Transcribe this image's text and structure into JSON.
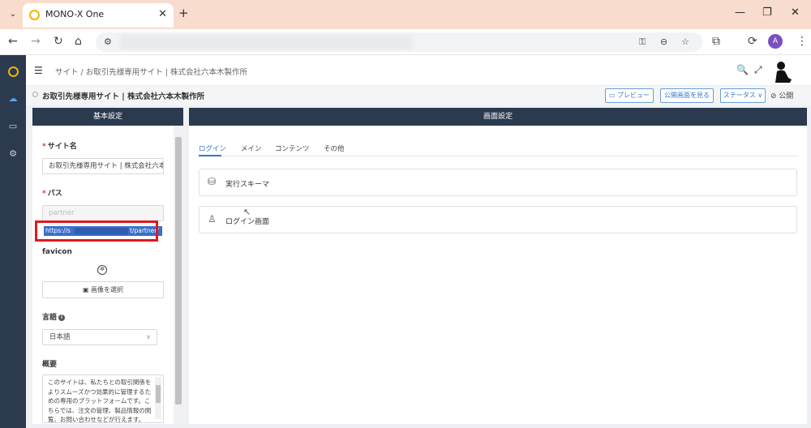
{
  "browser": {
    "tab_title": "MONO-X One",
    "tab_close": "✕",
    "new_tab": "+",
    "menu": "⌄",
    "window_minimize": "—",
    "window_restore": "❐",
    "window_close": "✕"
  },
  "toolbar": {
    "back": "←",
    "forward": "→",
    "reload": "↻",
    "home": "⌂",
    "site_info": "⚙",
    "key": "⚿",
    "zoom": "⊖",
    "bookmark": "☆",
    "extensions": "⧉",
    "sync": "⟳",
    "profile_initial": "A",
    "more": "⋮"
  },
  "header": {
    "breadcrumb": "サイト / お取引先様専用サイト | 株式会社六本木製作所",
    "search": "🔍",
    "fullscreen": "⤢"
  },
  "subheader": {
    "title": "お取引先様専用サイト | 株式会社六本木製作所",
    "preview": "▭ プレビュー",
    "view_public": "公開画面を見る",
    "status": "ステータス ∨",
    "publish": "⊘ 公開"
  },
  "left_panel": {
    "title": "基本設定",
    "site_name_label": "サイト名",
    "required_mark": "*",
    "site_name_value": "お取引先様専用サイト | 株式会社六本木製作所",
    "path_label": "パス",
    "path_placeholder": "partner",
    "url_start": "https://s",
    "url_end": "t/partner/",
    "favicon_label": "favicon",
    "favicon_glyph": "✲",
    "select_image": "▣ 画像を選択",
    "language_label": "言語",
    "info": "i",
    "language_value": "日本語",
    "chevron": "∨",
    "summary_label": "概要",
    "summary_text": "このサイトは、私たちとの取引関係をよりスムーズかつ効果的に管理するための専用のプラットフォームです。こちらでは、注文の管理、製品情報の閲覧、お問い合わせなどが行えます。"
  },
  "right_panel": {
    "title": "画面設定",
    "tabs": [
      "ログイン",
      "メイン",
      "コンテンツ",
      "その他"
    ],
    "cards": [
      {
        "icon": "⛁",
        "label": "実行スキーマ"
      },
      {
        "icon": "♙",
        "label": "ログイン画面"
      }
    ]
  },
  "nav": {
    "cloud": "☁",
    "folder": "▭",
    "settings": "⚙"
  }
}
